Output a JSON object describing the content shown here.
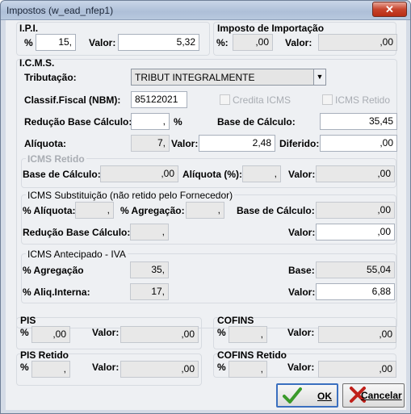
{
  "window": {
    "title": "Impostos (w_ead_nfep1)",
    "close_icon": "close-icon"
  },
  "ipi": {
    "header": "I.P.I.",
    "pct_label": "%",
    "pct_value": "15,",
    "valor_label": "Valor:",
    "valor_value": "5,32"
  },
  "importacao": {
    "header": "Imposto de Importação",
    "pct_label": "%:",
    "pct_value": ",00",
    "valor_label": "Valor:",
    "valor_value": ",00"
  },
  "icms": {
    "header": "I.C.M.S.",
    "tributacao_label": "Tributação:",
    "tributacao_value": "TRIBUT INTEGRALMENTE",
    "classif_label": "Classif.Fiscal (NBM):",
    "classif_value": "85122021",
    "credita_label": "Credita ICMS",
    "retido_check_label": "ICMS Retido",
    "reducao_label": "Redução Base Cálculo:",
    "reducao_value": ",",
    "reducao_pct": "%",
    "base_label": "Base de Cálculo:",
    "base_value": "35,45",
    "aliquota_label": "Alíquota:",
    "aliquota_value": "7,",
    "valor_label": "Valor:",
    "valor_value": "2,48",
    "diferido_label": "Diferido:",
    "diferido_value": ",00"
  },
  "icms_retido": {
    "header": "ICMS Retido",
    "base_label": "Base de Cálculo:",
    "base_value": ",00",
    "aliquota_label": "Alíquota (%):",
    "aliquota_value": ",",
    "valor_label": "Valor:",
    "valor_value": ",00"
  },
  "icms_st": {
    "header": "ICMS Substituição (não retido pelo Fornecedor)",
    "aliquota_label": "% Alíquota:",
    "aliquota_value": ",",
    "agregacao_label": "% Agregação:",
    "agregacao_value": ",",
    "base_label": "Base de Cálculo:",
    "base_value": ",00",
    "reducao_label": "Redução Base Cálculo:",
    "reducao_value": ",",
    "valor_label": "Valor:",
    "valor_value": ",00"
  },
  "icms_antecipado": {
    "header": "ICMS Antecipado - IVA",
    "agregacao_label": "% Agregação",
    "agregacao_value": "35,",
    "base_label": "Base:",
    "base_value": "55,04",
    "aliq_label": "% Aliq.Interna:",
    "aliq_value": "17,",
    "valor_label": "Valor:",
    "valor_value": "6,88"
  },
  "pis": {
    "header": "PIS",
    "pct_label": "%",
    "pct_value": ",00",
    "valor_label": "Valor:",
    "valor_value": ",00"
  },
  "cofins": {
    "header": "COFINS",
    "pct_label": "%",
    "pct_value": ",",
    "valor_label": "Valor:",
    "valor_value": ",00"
  },
  "pis_retido": {
    "header": "PIS Retido",
    "pct_label": "%",
    "pct_value": ",",
    "valor_label": "Valor:",
    "valor_value": ",00"
  },
  "cofins_retido": {
    "header": "COFINS Retido",
    "pct_label": "%",
    "pct_value": ",",
    "valor_label": "Valor:",
    "valor_value": ",00"
  },
  "buttons": {
    "ok_label": "OK",
    "cancel_label": "Cancelar",
    "ok_icon": "checkmark-icon",
    "cancel_icon": "x-icon"
  },
  "colors": {
    "ok_check": "#3a9a2a",
    "cancel_x": "#c0201a"
  }
}
